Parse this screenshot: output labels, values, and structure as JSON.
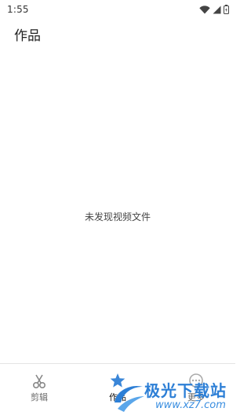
{
  "status_bar": {
    "time": "1:55",
    "icons": [
      "wifi-icon",
      "signal-icon",
      "battery-icon"
    ]
  },
  "header": {
    "title": "作品"
  },
  "main": {
    "empty_message": "未发现视频文件"
  },
  "bottom_nav": {
    "items": [
      {
        "label": "剪辑",
        "icon": "scissors-icon",
        "active": false
      },
      {
        "label": "作品",
        "icon": "star-icon",
        "active": true
      },
      {
        "label": "更多",
        "icon": "more-icon",
        "active": false
      }
    ]
  },
  "watermark": {
    "brand": "极光下载站",
    "url": "www.xz7.com"
  },
  "colors": {
    "background": "#ffffff",
    "text": "#222222",
    "watermark_blue": "#2d7fd6",
    "nav_border": "#e4e4e4"
  }
}
